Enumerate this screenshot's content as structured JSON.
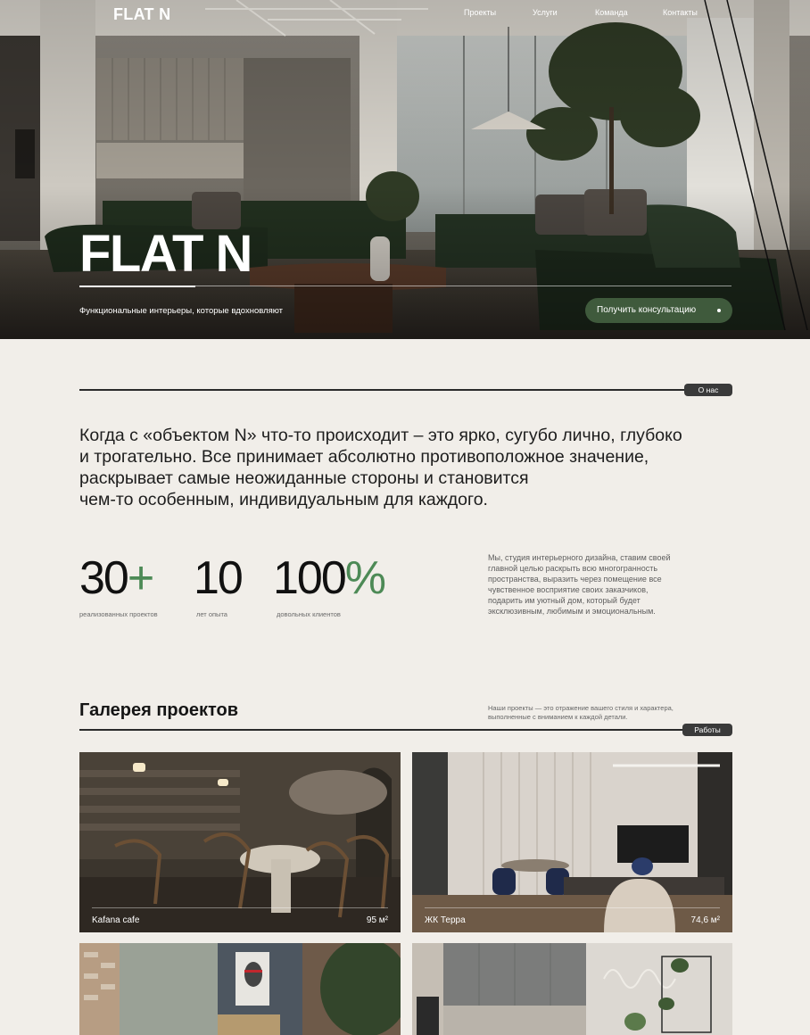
{
  "header": {
    "logo": "FLAT N",
    "nav": [
      "Проекты",
      "Услуги",
      "Команда",
      "Контакты"
    ]
  },
  "hero": {
    "title": "FLAT N",
    "subtitle": "Функциональные интерьеры, которые вдохновляют",
    "cta_label": "Получить консультацию"
  },
  "about": {
    "tag": "О нас",
    "lead_lines": [
      "Когда с «объектом N» что-то происходит – это ярко, сугубо лично, глубоко",
      "и трогательно. Все принимает абсолютно противоположное значение,",
      "раскрывает самые неожиданные стороны и становится",
      "чем-то особенным, индивидуальным для каждого."
    ],
    "stats": [
      {
        "value": "30",
        "accent": "+",
        "label": "реализованных проектов"
      },
      {
        "value": "10",
        "accent": "",
        "label": "лет опыта"
      },
      {
        "value": "100",
        "accent": "%",
        "label": "довольных клиентов"
      }
    ],
    "description_lines": [
      "Мы, студия интерьерного дизайна, ставим своей",
      "главной целью раскрыть всю многогранность",
      "пространства, выразить через помещение все",
      "чувственное восприятие своих заказчиков,",
      "подарить им уютный дом, который будет",
      "эксклюзивным, любимым и эмоциональным."
    ]
  },
  "gallery": {
    "title": "Галерея проектов",
    "subtitle_lines": [
      "Наши проекты — это отражение вашего стиля и характера,",
      "выполненные с вниманием к каждой детали."
    ],
    "tag": "Работы",
    "projects": [
      {
        "name": "Kafana cafe",
        "area": "95 м²"
      },
      {
        "name": "ЖК Терра",
        "area": "74,6 м²"
      },
      {
        "name": "",
        "area": ""
      },
      {
        "name": "",
        "area": ""
      }
    ]
  },
  "colors": {
    "background": "#f1eee9",
    "accent_green": "#4d8a56",
    "cta_green": "#3f5a3c",
    "tag_dark": "#3a3a3a"
  }
}
